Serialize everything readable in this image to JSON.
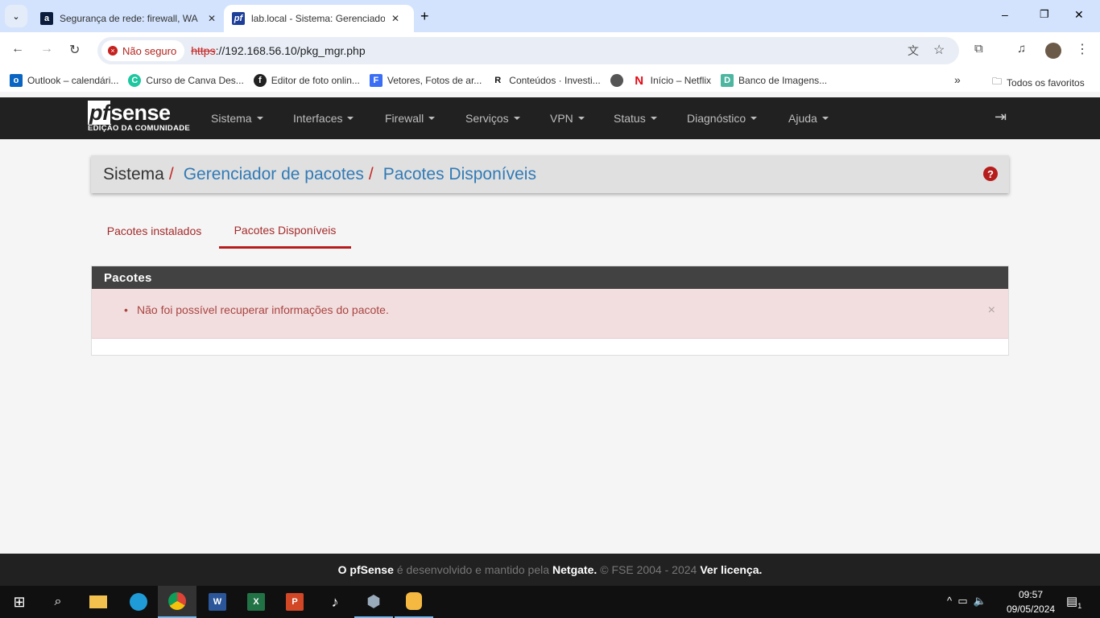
{
  "browser": {
    "tabs": [
      {
        "title": "Segurança de rede: firewall, WA",
        "icon": "a-icon"
      },
      {
        "title": "lab.local - Sistema: Gerenciador",
        "icon": "pfsense-icon",
        "active": true
      }
    ],
    "security_label": "Não seguro",
    "url_scheme": "https",
    "url_rest": "://192.168.56.10/pkg_mgr.php",
    "bookmarks": [
      "Outlook – calendári...",
      "Curso de Canva Des...",
      "Editor de foto onlin...",
      "Vetores, Fotos de ar...",
      "Conteúdos · Investi...",
      "",
      "Início – Netflix",
      "Banco de Imagens..."
    ],
    "all_bookmarks": "Todos os favoritos"
  },
  "pfsense": {
    "logo": "pfsense",
    "edition": "EDIÇÃO DA COMUNIDADE",
    "menu": [
      "Sistema",
      "Interfaces",
      "Firewall",
      "Serviços",
      "VPN",
      "Status",
      "Diagnóstico",
      "Ajuda"
    ],
    "breadcrumb": [
      "Sistema",
      "Gerenciador de pacotes",
      "Pacotes Disponíveis"
    ],
    "tabs": [
      "Pacotes instalados",
      "Pacotes Disponíveis"
    ],
    "active_tab": 1,
    "panel_title": "Pacotes",
    "error": "Não foi possível recuperar informações do pacote.",
    "footer": {
      "a": "O pfSense",
      "b": "é desenvolvido e mantido pela",
      "c": "Netgate.",
      "d": "© FSE 2004 - 2024",
      "e": "Ver licença."
    },
    "colors": {
      "nav": "#212121",
      "accent": "#b71c1c",
      "link": "#317ab6",
      "alert_bg": "#f2dede"
    }
  },
  "taskbar": {
    "time": "09:57",
    "date": "09/05/2024",
    "notifications": "1"
  }
}
